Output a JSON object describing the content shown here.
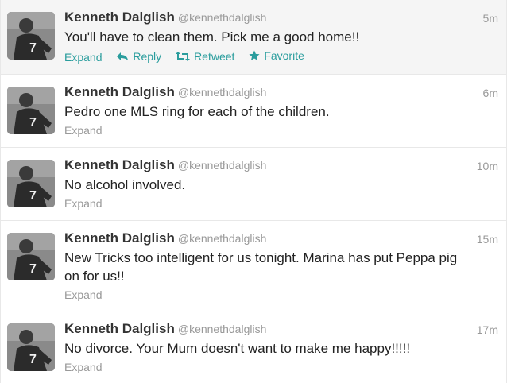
{
  "tweets": [
    {
      "name": "Kenneth Dalglish",
      "handle": "@kennethdalglish",
      "time": "5m",
      "text": "You'll have to clean them. Pick me a good home!!",
      "expand": "Expand",
      "actions": {
        "reply": "Reply",
        "retweet": "Retweet",
        "favorite": "Favorite"
      }
    },
    {
      "name": "Kenneth Dalglish",
      "handle": "@kennethdalglish",
      "time": "6m",
      "text": "Pedro one MLS ring for each of the children.",
      "expand": "Expand"
    },
    {
      "name": "Kenneth Dalglish",
      "handle": "@kennethdalglish",
      "time": "10m",
      "text": "No alcohol involved.",
      "expand": "Expand"
    },
    {
      "name": "Kenneth Dalglish",
      "handle": "@kennethdalglish",
      "time": "15m",
      "text": "New Tricks too intelligent for us tonight. Marina has put Peppa pig on for us!!",
      "expand": "Expand"
    },
    {
      "name": "Kenneth Dalglish",
      "handle": "@kennethdalglish",
      "time": "17m",
      "text": "No divorce. Your Mum doesn't want to make me happy!!!!!",
      "expand": "Expand"
    }
  ],
  "colors": {
    "link": "#2a9d9d",
    "muted": "#999999",
    "highlight_row": "#f5f5f5"
  },
  "avatar_jersey_number": "7"
}
